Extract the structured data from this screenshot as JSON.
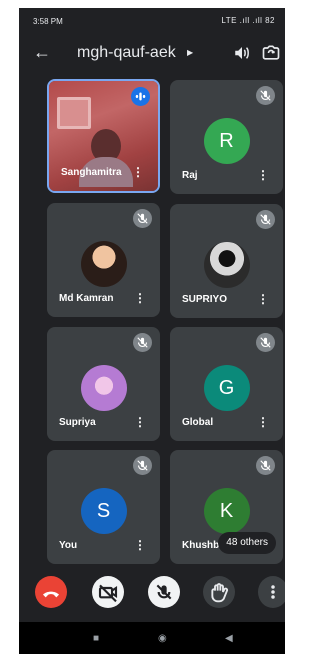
{
  "status_bar": {
    "time": "3:58 PM",
    "icons": "signal-wifi-battery-icons",
    "right_text": "LTE .ıll .ıll 82"
  },
  "app_bar": {
    "meeting_code": "mgh-qauf-aek",
    "back_icon": "arrow-back-icon",
    "speaker_icon": "speaker-icon",
    "switch_camera_icon": "switch-camera-icon"
  },
  "participants": [
    {
      "name": "Sanghamitra",
      "avatar_type": "video",
      "mic": "speaking"
    },
    {
      "name": "Raj",
      "initial": "R",
      "avatar_color": "#34a853",
      "mic": "muted"
    },
    {
      "name": "Md Kamran",
      "avatar_type": "photo",
      "mic": "muted"
    },
    {
      "name": "SUPRIYO",
      "avatar_type": "photo",
      "mic": "muted"
    },
    {
      "name": "Supriya",
      "avatar_type": "photo",
      "mic": "muted"
    },
    {
      "name": "Global",
      "initial": "G",
      "avatar_color": "#0b8a7a",
      "mic": "muted"
    },
    {
      "name": "You",
      "initial": "S",
      "avatar_color": "#1565c0",
      "mic": "muted"
    },
    {
      "name": "Khushb",
      "initial": "K",
      "avatar_color": "#2e7d32",
      "mic": "muted"
    }
  ],
  "others_label": "48 others",
  "controls": {
    "end_call_icon": "end-call-icon",
    "camera_off_icon": "camera-off-icon",
    "mic_off_icon": "mic-off-icon",
    "raise_hand_icon": "raise-hand-icon",
    "more_icon": "more-vert-icon"
  },
  "navbar": {
    "recents": "■",
    "home": "◉",
    "back": "◀"
  }
}
